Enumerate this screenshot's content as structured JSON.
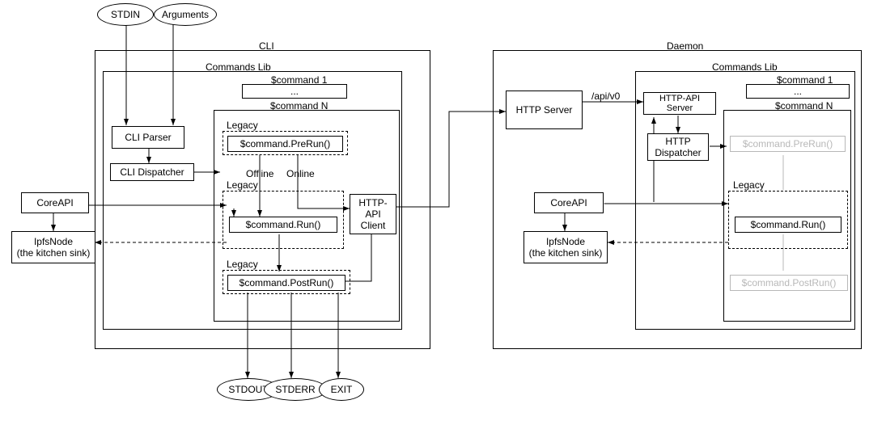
{
  "inputs": {
    "stdin": "STDIN",
    "arguments": "Arguments"
  },
  "outputs": {
    "stdout": "STDOUT",
    "stderr": "STDERR",
    "exit": "EXIT"
  },
  "cli": {
    "title": "CLI",
    "commandsLib": "Commands Lib",
    "cmd1": "$command 1",
    "dots": "...",
    "cmdN": "$command N",
    "parser": "CLI Parser",
    "dispatcher": "CLI Dispatcher",
    "legacy": "Legacy",
    "prerun": "$command.PreRun()",
    "run": "$command.Run()",
    "postrun": "$command.PostRun()",
    "offline": "Offline",
    "online": "Online",
    "httpClient": "HTTP-API Client"
  },
  "left": {
    "coreapi": "CoreAPI",
    "ipfsnode": "IpfsNode\n(the kitchen sink)"
  },
  "daemon": {
    "title": "Daemon",
    "httpServer": "HTTP Server",
    "apiV0": "/api/v0",
    "httpApiServer": "HTTP-API Server",
    "httpDispatcher": "HTTP Dispatcher",
    "commandsLib": "Commands Lib",
    "cmd1": "$command 1",
    "dots": "...",
    "cmdN": "$command N",
    "legacy": "Legacy",
    "prerun": "$command.PreRun()",
    "run": "$command.Run()",
    "postrun": "$command.PostRun()",
    "coreapi": "CoreAPI",
    "ipfsnode": "IpfsNode\n(the kitchen sink)"
  }
}
